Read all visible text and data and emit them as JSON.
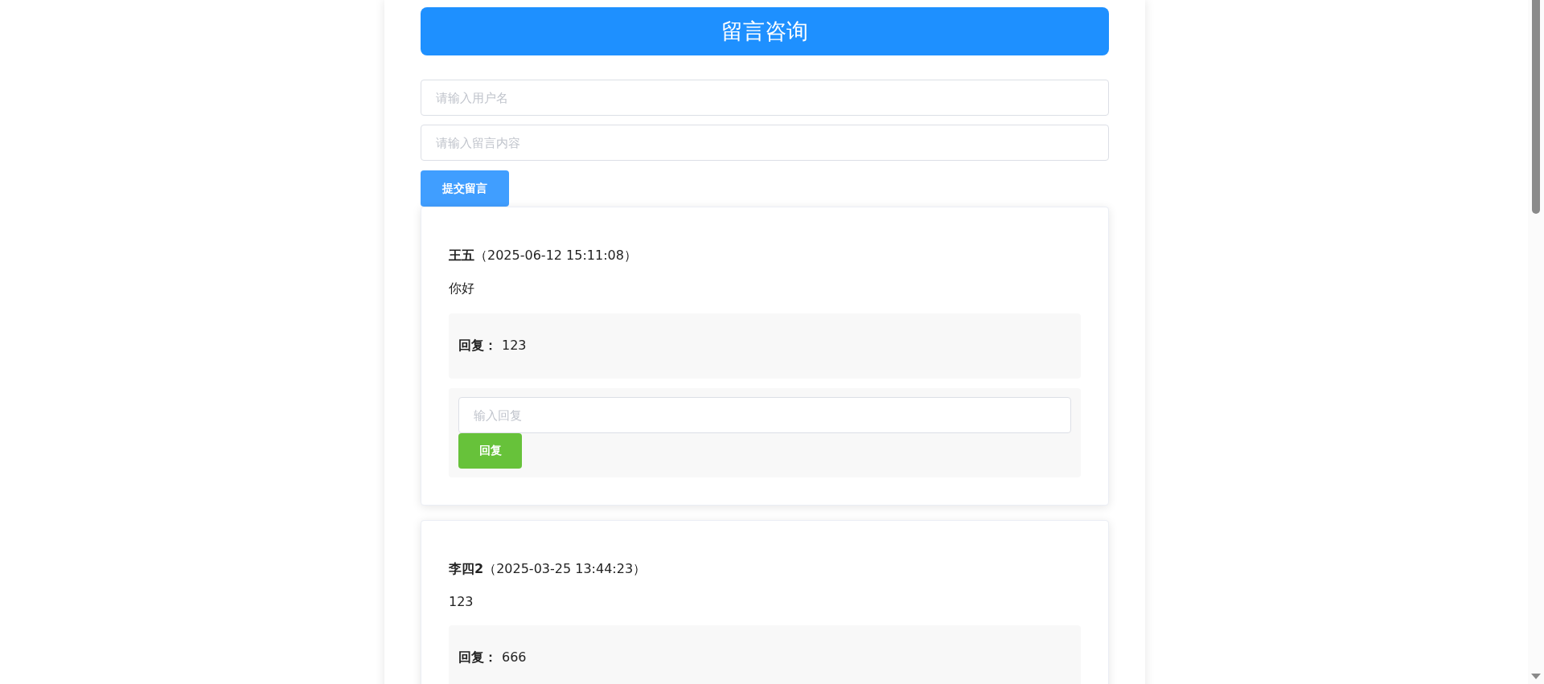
{
  "title": "留言咨询",
  "fields": [
    {
      "placeholder": "请输入用户名"
    },
    {
      "placeholder": "请输入留言内容"
    }
  ],
  "submit_button": "提交留言",
  "messages": [
    {
      "author": "王五",
      "time": "（2025-06-12 15:11:08）",
      "content": "你好",
      "reply_label": "回复：",
      "reply": "123",
      "reply_form": {
        "placeholder": "输入回复",
        "button": "回复"
      }
    },
    {
      "author": "李四2",
      "time": "（2025-03-25 13:44:23）",
      "content": "123",
      "reply_label": "回复：",
      "reply": "666"
    }
  ]
}
